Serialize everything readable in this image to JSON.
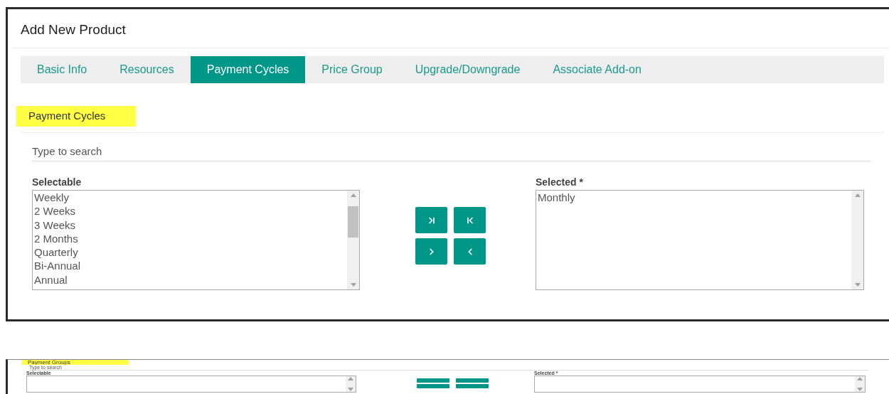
{
  "panel": {
    "title": "Add New Product",
    "tabs": [
      {
        "label": "Basic Info",
        "selected": false
      },
      {
        "label": "Resources",
        "selected": false
      },
      {
        "label": "Payment Cycles",
        "selected": true
      },
      {
        "label": "Price Group",
        "selected": false
      },
      {
        "label": "Upgrade/Downgrade",
        "selected": false
      },
      {
        "label": "Associate Add-on",
        "selected": false
      }
    ],
    "section": {
      "heading": "Payment Cycles",
      "search": {
        "placeholder": "Type to search"
      },
      "selectable": {
        "label": "Selectable",
        "items": [
          "Weekly",
          "2 Weeks",
          "3 Weeks",
          "2 Months",
          "Quarterly",
          "Bi-Annual",
          "Annual"
        ]
      },
      "transfer_buttons": [
        {
          "kind": "move_all_right"
        },
        {
          "kind": "move_all_left"
        },
        {
          "kind": "move_right"
        },
        {
          "kind": "move_left"
        }
      ],
      "selected": {
        "label": "Selected *",
        "items": [
          "Monthly"
        ]
      }
    }
  },
  "second_section": {
    "heading": "Payment Groups",
    "search": {
      "placeholder": "Type to search"
    },
    "selectable": {
      "label": "Selectable"
    },
    "selected": {
      "label": "Selected *"
    }
  }
}
